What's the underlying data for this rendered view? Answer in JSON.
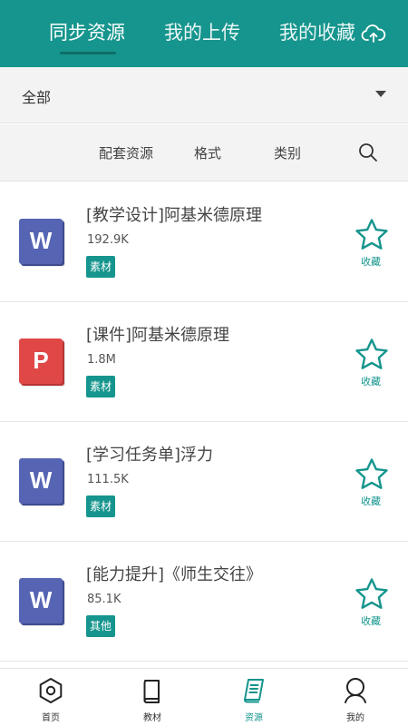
{
  "header": {
    "tabs": [
      {
        "label": "同步资源",
        "active": true
      },
      {
        "label": "我的上传",
        "active": false
      },
      {
        "label": "我的收藏",
        "active": false
      }
    ],
    "icon": "cloud-upload-icon"
  },
  "filter": {
    "selected": "全部",
    "options": [
      "配套资源",
      "格式",
      "类别"
    ],
    "search_icon": "search-icon"
  },
  "resources": [
    {
      "icon_letter": "W",
      "icon_type": "word",
      "title": "[教学设计]阿基米德原理",
      "size": "192.9K",
      "tag": "素材",
      "fav_label": "收藏"
    },
    {
      "icon_letter": "P",
      "icon_type": "ppt",
      "title": "[课件]阿基米德原理",
      "size": "1.8M",
      "tag": "素材",
      "fav_label": "收藏"
    },
    {
      "icon_letter": "W",
      "icon_type": "word",
      "title": "[学习任务单]浮力",
      "size": "111.5K",
      "tag": "素材",
      "fav_label": "收藏"
    },
    {
      "icon_letter": "W",
      "icon_type": "word",
      "title": "[能力提升]《师生交往》",
      "size": "85.1K",
      "tag": "其他",
      "fav_label": "收藏"
    }
  ],
  "bottom_nav": [
    {
      "label": "首页",
      "icon": "home-hexagon-icon",
      "active": false
    },
    {
      "label": "教材",
      "icon": "book-icon",
      "active": false
    },
    {
      "label": "资源",
      "icon": "resource-book-icon",
      "active": true
    },
    {
      "label": "我的",
      "icon": "user-icon",
      "active": false
    }
  ],
  "colors": {
    "accent": "#15958d",
    "word_icon": "#5565b3",
    "ppt_icon": "#e04848"
  }
}
